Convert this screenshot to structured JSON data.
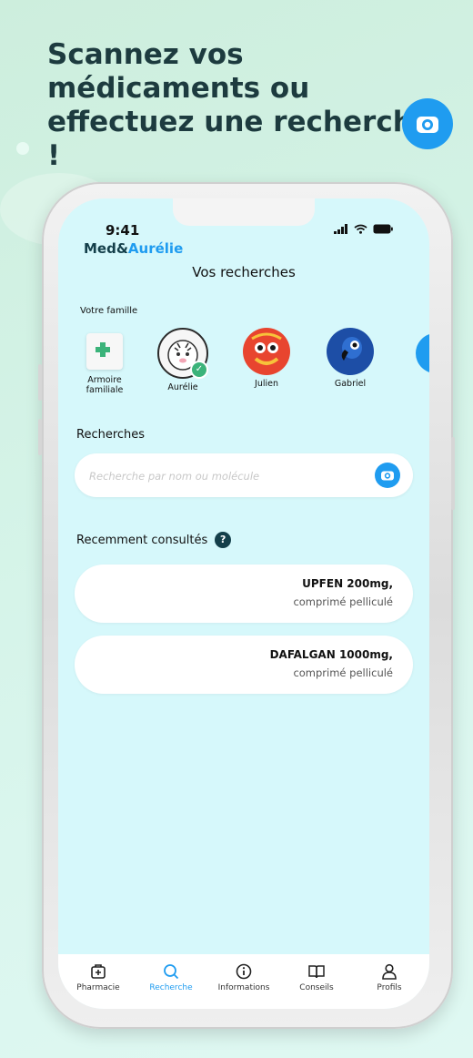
{
  "promo": {
    "title": "Scannez vos médicaments ou effectuez une recherche !",
    "camera_icon": "camera-icon"
  },
  "status": {
    "time": "9:41",
    "icons": [
      "signal-icon",
      "wifi-icon",
      "battery-icon"
    ]
  },
  "brand": {
    "prefix": "Med&",
    "accent": "Aurélie"
  },
  "screen_title": "Vos recherches",
  "family": {
    "label": "Votre famille",
    "members": [
      {
        "name": "Armoire familiale",
        "icon": "medicine-cabinet-icon"
      },
      {
        "name": "Aurélie",
        "icon": "white-tiger-avatar",
        "selected": true
      },
      {
        "name": "Julien",
        "icon": "lion-dance-avatar"
      },
      {
        "name": "Gabriel",
        "icon": "parrot-avatar"
      }
    ]
  },
  "search": {
    "label": "Recherches",
    "placeholder": "Recherche par nom ou molécule"
  },
  "recent": {
    "label": "Recemment consultés",
    "help": "?",
    "items": [
      {
        "name": "UPFEN 200mg,",
        "form": "comprimé pelliculé"
      },
      {
        "name": "DAFALGAN 1000mg,",
        "form": "comprimé pelliculé"
      }
    ]
  },
  "tabs": [
    {
      "label": "Pharmacie",
      "icon": "pharmacy-icon"
    },
    {
      "label": "Recherche",
      "icon": "search-icon",
      "active": true
    },
    {
      "label": "Informations",
      "icon": "info-icon"
    },
    {
      "label": "Conseils",
      "icon": "book-icon"
    },
    {
      "label": "Profils",
      "icon": "profile-icon"
    }
  ],
  "colors": {
    "accent": "#1f9cf0",
    "screen_bg": "#d6f8fb",
    "dark": "#143f4a",
    "selected_badge": "#3bb37a"
  }
}
